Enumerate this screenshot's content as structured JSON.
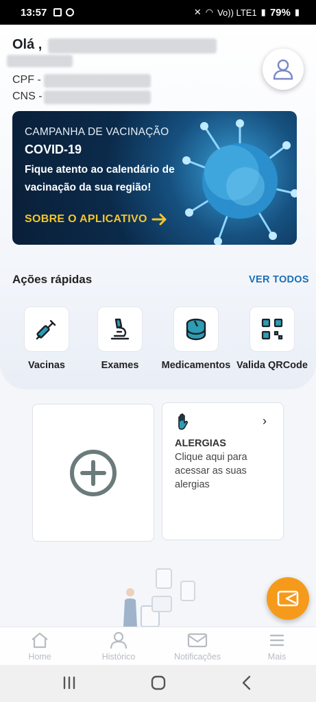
{
  "status_bar": {
    "time": "13:57",
    "network": "Vo)) LTE1",
    "battery": "79%"
  },
  "header": {
    "greeting": "Olá ,",
    "cpf_label": "CPF -",
    "cns_label": "CNS -"
  },
  "banner": {
    "subtitle": "CAMPANHA DE VACINAÇÃO",
    "title": "COVID-19",
    "text": "Fique atento ao calendário de vacinação da sua região!",
    "cta": "SOBRE O APLICATIVO",
    "cta_color": "#f5c52a"
  },
  "quick_actions": {
    "title": "Ações rápidas",
    "see_all": "VER TODOS",
    "items": [
      {
        "label": "Vacinas",
        "icon": "syringe-icon"
      },
      {
        "label": "Exames",
        "icon": "microscope-icon"
      },
      {
        "label": "Medicamentos",
        "icon": "pill-icon"
      },
      {
        "label": "Valida QRCode",
        "icon": "qrcode-icon"
      }
    ]
  },
  "cards": {
    "add_icon": "plus-circle-icon",
    "allergy": {
      "title": "ALERGIAS",
      "text": "Clique aqui para acessar as suas alergias",
      "icon": "hand-icon"
    }
  },
  "fab": {
    "icon": "card-send-icon",
    "color": "#f59a1b"
  },
  "bottom_nav": {
    "items": [
      {
        "label": "Home",
        "icon": "home-icon"
      },
      {
        "label": "Histórico",
        "icon": "user-icon"
      },
      {
        "label": "Notificações",
        "icon": "mail-icon"
      },
      {
        "label": "Mais",
        "icon": "menu-icon"
      }
    ]
  },
  "colors": {
    "accent_blue": "#1b6fb6",
    "teal_icon": "#1f8a9c"
  }
}
